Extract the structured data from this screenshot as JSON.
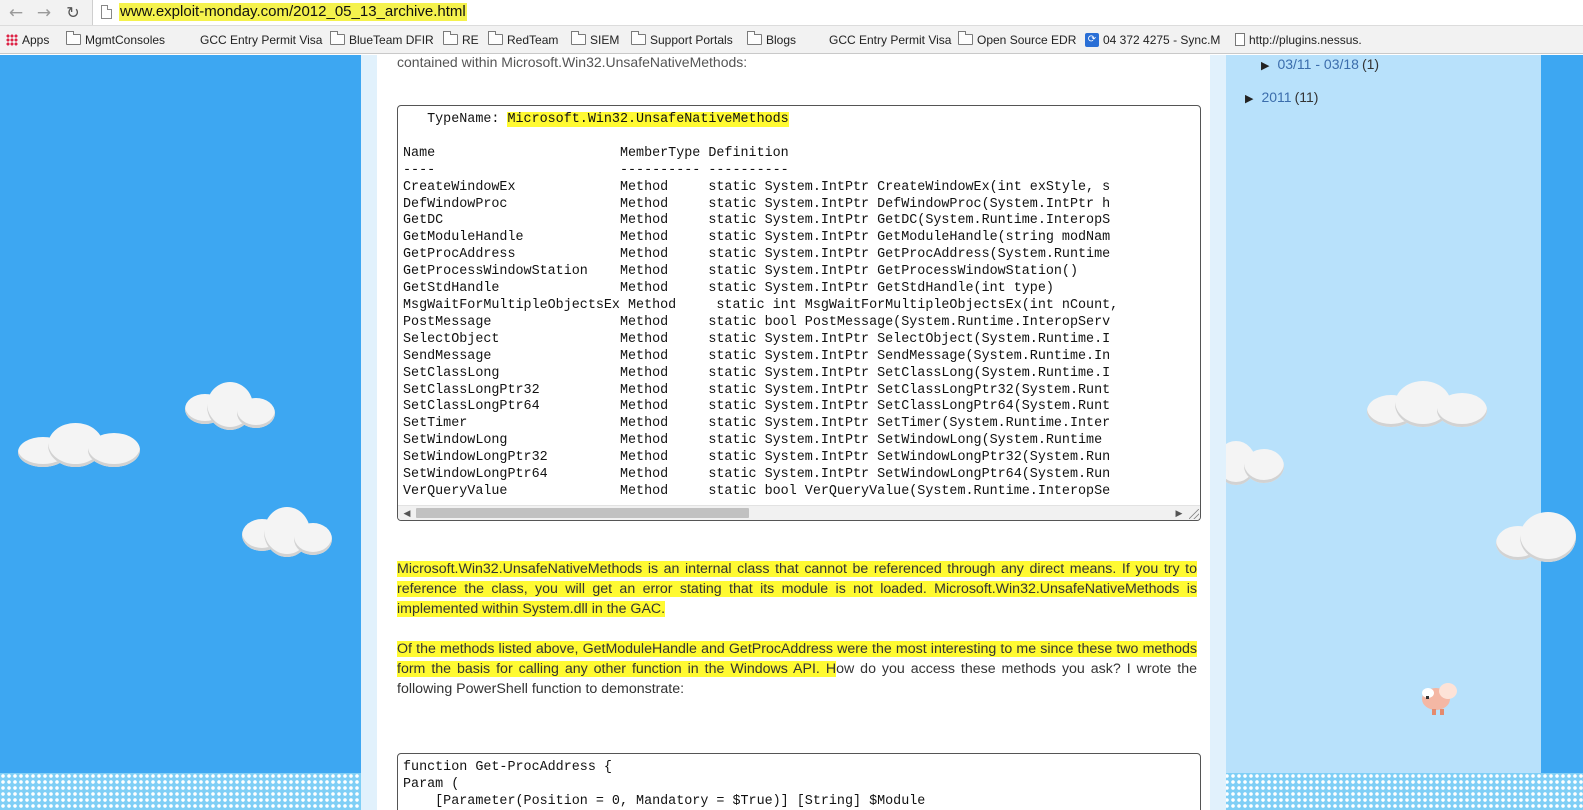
{
  "browser": {
    "url": "www.exploit-monday.com/2012_05_13_archive.html",
    "nav": {
      "back_icon": "←",
      "forward_icon": "→",
      "reload_icon": "↻"
    }
  },
  "bookmarks": [
    {
      "label": "Apps",
      "icon": "apps-icon"
    },
    {
      "label": "MgmtConsoles",
      "icon": "folder-icon"
    },
    {
      "label": "GCC Entry Permit Visa",
      "icon": "none"
    },
    {
      "label": "BlueTeam DFIR",
      "icon": "folder-icon"
    },
    {
      "label": "RE",
      "icon": "folder-icon"
    },
    {
      "label": "RedTeam",
      "icon": "folder-icon"
    },
    {
      "label": "SIEM",
      "icon": "folder-icon"
    },
    {
      "label": "Support Portals",
      "icon": "folder-icon"
    },
    {
      "label": "Blogs",
      "icon": "folder-icon"
    },
    {
      "label": "GCC Entry Permit Visa",
      "icon": "none"
    },
    {
      "label": "Open Source EDR",
      "icon": "folder-icon"
    },
    {
      "label": "04 372 4275 - Sync.M",
      "icon": "sync-icon"
    },
    {
      "label": "http://plugins.nessus.",
      "icon": "page-icon"
    }
  ],
  "post": {
    "intro": "contained within Microsoft.Win32.UnsafeNativeMethods:",
    "typename_label": "   TypeName: ",
    "typename_value": "Microsoft.Win32.UnsafeNativeMethods",
    "table_lines": [
      "",
      "Name                       MemberType Definition",
      "----                       ---------- ----------",
      "CreateWindowEx             Method     static System.IntPtr CreateWindowEx(int exStyle, s",
      "DefWindowProc              Method     static System.IntPtr DefWindowProc(System.IntPtr h",
      "GetDC                      Method     static System.IntPtr GetDC(System.Runtime.InteropS",
      "GetModuleHandle            Method     static System.IntPtr GetModuleHandle(string modNam",
      "GetProcAddress             Method     static System.IntPtr GetProcAddress(System.Runtime",
      "GetProcessWindowStation    Method     static System.IntPtr GetProcessWindowStation()",
      "GetStdHandle               Method     static System.IntPtr GetStdHandle(int type)",
      "MsgWaitForMultipleObjectsEx Method     static int MsgWaitForMultipleObjectsEx(int nCount,",
      "PostMessage                Method     static bool PostMessage(System.Runtime.InteropServ",
      "SelectObject               Method     static System.IntPtr SelectObject(System.Runtime.I",
      "SendMessage                Method     static System.IntPtr SendMessage(System.Runtime.In",
      "SetClassLong               Method     static System.IntPtr SetClassLong(System.Runtime.I",
      "SetClassLongPtr32          Method     static System.IntPtr SetClassLongPtr32(System.Runt",
      "SetClassLongPtr64          Method     static System.IntPtr SetClassLongPtr64(System.Runt",
      "SetTimer                   Method     static System.IntPtr SetTimer(System.Runtime.Inter",
      "SetWindowLong              Method     static System.IntPtr SetWindowLong(System.Runtime",
      "SetWindowLongPtr32         Method     static System.IntPtr SetWindowLongPtr32(System.Run",
      "SetWindowLongPtr64         Method     static System.IntPtr SetWindowLongPtr64(System.Run",
      "VerQueryValue              Method     static bool VerQueryValue(System.Runtime.InteropSe"
    ],
    "para1": "Microsoft.Win32.UnsafeNativeMethods is an internal class that cannot be referenced through any direct means. If you try to reference the class, you will get an error stating that its module is not loaded. Microsoft.Win32.UnsafeNativeMethods is implemented within System.dll in the GAC.",
    "para2": "Of the methods listed above, GetModuleHandle and GetProcAddress were the most interesting to me since these two methods form the basis for calling any other function in the Windows API. How do you access these methods you ask? I wrote the following PowerShell function to demonstrate:",
    "code2_lines": [
      "function Get-ProcAddress {",
      "Param (",
      "    [Parameter(Position = 0, Mandatory = $True)] [String] $Module"
    ]
  },
  "sidebar": {
    "items": [
      {
        "label": "03/11 - 03/18",
        "count": "(1)"
      },
      {
        "label": "2011",
        "count": "(11)"
      }
    ]
  },
  "colors": {
    "highlight": "#fffa32",
    "sky": "#3da7f2",
    "sidebar_bg": "#b8e1fb",
    "link": "#3b6dac"
  }
}
